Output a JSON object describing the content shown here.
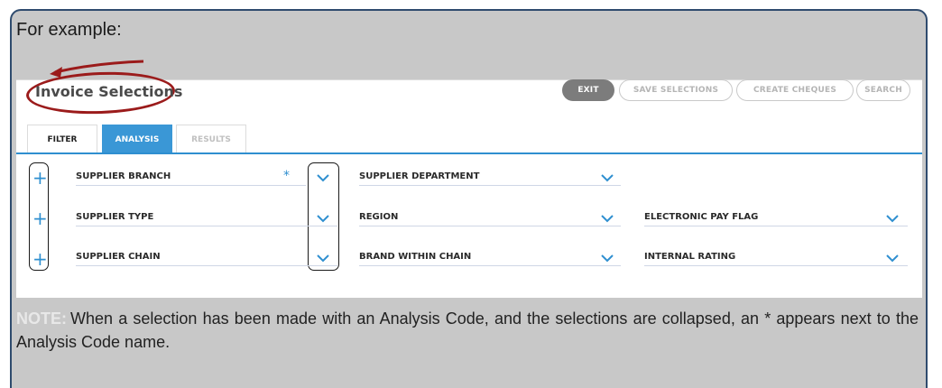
{
  "caption": "For example:",
  "app": {
    "title": "Invoice Selections"
  },
  "toolbar": {
    "exit": "EXIT",
    "save": "SAVE SELECTIONS",
    "cheques": "CREATE CHEQUES",
    "search": "SEARCH"
  },
  "tabs": {
    "filter": "FILTER",
    "analysis": "ANALYSIS",
    "results": "RESULTS"
  },
  "fields": {
    "supplier_branch": "SUPPLIER BRANCH",
    "supplier_branch_marker": "*",
    "supplier_department": "SUPPLIER DEPARTMENT",
    "supplier_type": "SUPPLIER TYPE",
    "region": "REGION",
    "electronic_pay_flag": "ELECTRONIC PAY FLAG",
    "supplier_chain": "SUPPLIER CHAIN",
    "brand_within_chain": "BRAND WITHIN CHAIN",
    "internal_rating": "INTERNAL RATING"
  },
  "note": {
    "label": "NOTE:",
    "text": "When a selection has been made with an Analysis Code, and the selections are collapsed, an * appears next to the Analysis Code name."
  },
  "colors": {
    "accent": "#2f8fd0",
    "highlight_oval": "#9b1b1b",
    "frame_border": "#2f4b6e"
  }
}
